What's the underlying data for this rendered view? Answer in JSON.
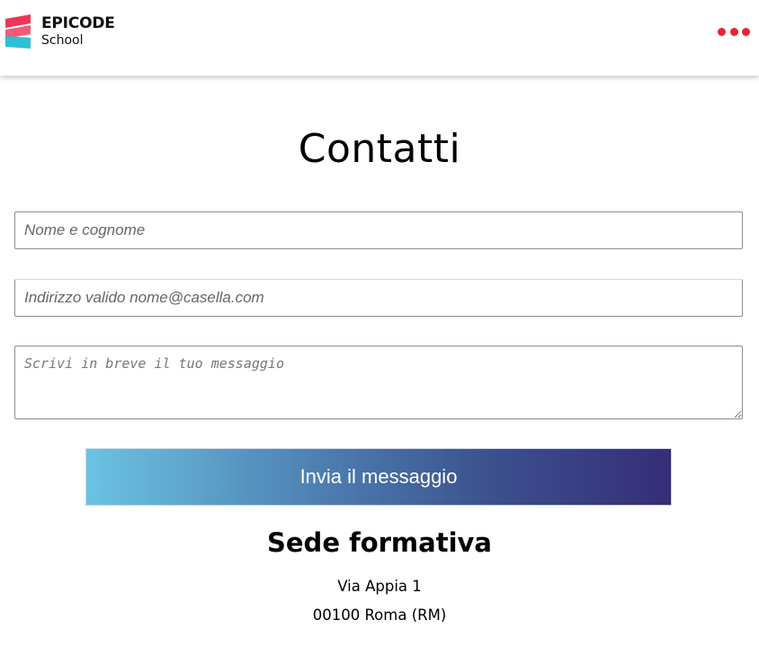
{
  "header": {
    "logo_title": "EPICODE",
    "logo_subtitle": "School",
    "menu_icon": "more-horizontal-icon",
    "accent_color": "#e8232e",
    "logo_colors": [
      "#ef3658",
      "#f0476a",
      "#2bc0d4"
    ]
  },
  "main": {
    "title": "Contatti",
    "form": {
      "name_placeholder": "Nome e cognome",
      "email_placeholder": "Indirizzo valido nome@casella.com",
      "message_placeholder": "Scrivi in breve il tuo messaggio",
      "submit_label": "Invia il messaggio",
      "submit_gradient": [
        "#6bc3e3",
        "#362d77"
      ]
    },
    "location": {
      "title": "Sede formativa",
      "address_line1": "Via Appia 1",
      "address_line2": "00100 Roma (RM)"
    }
  }
}
